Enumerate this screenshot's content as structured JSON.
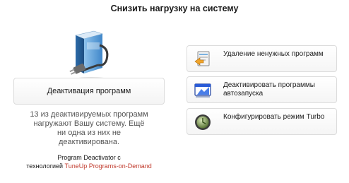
{
  "header": {
    "title": "Снизить нагрузку на систему"
  },
  "main": {
    "deactivate_label": "Деактивация программ",
    "status_text": "13 из деактивируемых программ нагружают Вашу систему. Ещё ни одна из них не деактивирована.",
    "credit": {
      "line1": "Program Deactivator с",
      "line2_prefix": "технологией ",
      "line2_highlight": "TuneUp Programs-on-Demand",
      "highlight_color": "#c0392b"
    }
  },
  "actions": {
    "remove_label": "Удаление ненужных программ",
    "autostart_label": "Деактивировать программы автозапуска",
    "turbo_label": "Конфигурировать режим Turbo"
  },
  "icons": {
    "main": "program-deactivator-icon",
    "remove": "uninstall-programs-icon",
    "autostart": "startup-manager-icon",
    "turbo": "turbo-mode-icon"
  }
}
